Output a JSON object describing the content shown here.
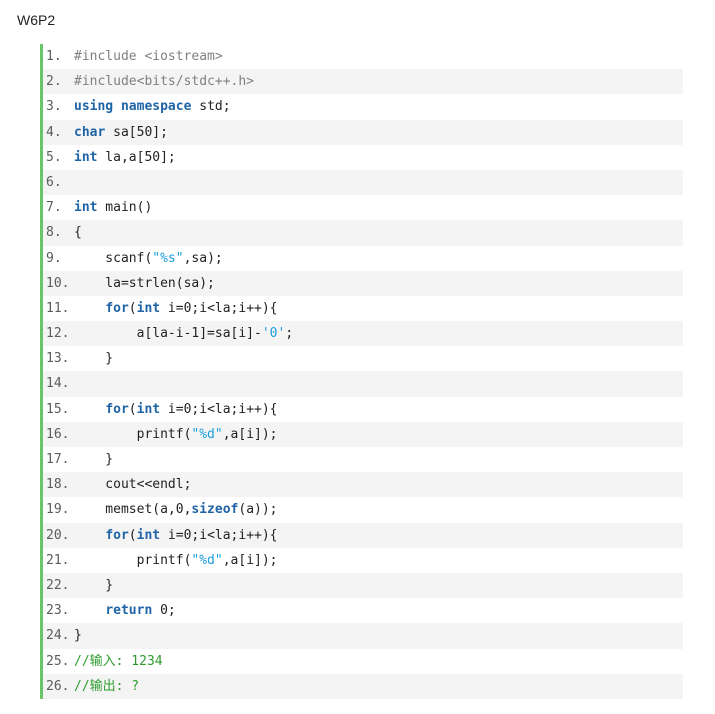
{
  "title": "W6P2",
  "lines": [
    {
      "n": "1.",
      "tokens": [
        {
          "t": "#include <iostream>",
          "c": "muted"
        }
      ]
    },
    {
      "n": "2.",
      "tokens": [
        {
          "t": "#include<bits/stdc++.h>",
          "c": "muted"
        }
      ]
    },
    {
      "n": "3.",
      "tokens": [
        {
          "t": "using",
          "c": "kw"
        },
        {
          "t": " ",
          "c": "plain"
        },
        {
          "t": "namespace",
          "c": "kw"
        },
        {
          "t": " std;",
          "c": "plain"
        }
      ]
    },
    {
      "n": "4.",
      "tokens": [
        {
          "t": "char",
          "c": "kw"
        },
        {
          "t": " sa[50];",
          "c": "plain"
        }
      ]
    },
    {
      "n": "5.",
      "tokens": [
        {
          "t": "int",
          "c": "kw"
        },
        {
          "t": " la,a[50];",
          "c": "plain"
        }
      ]
    },
    {
      "n": "6.",
      "tokens": []
    },
    {
      "n": "7.",
      "tokens": [
        {
          "t": "int",
          "c": "kw"
        },
        {
          "t": " main()",
          "c": "plain"
        }
      ]
    },
    {
      "n": "8.",
      "tokens": [
        {
          "t": "{",
          "c": "plain"
        }
      ]
    },
    {
      "n": "9.",
      "tokens": [
        {
          "t": "    scanf(",
          "c": "plain"
        },
        {
          "t": "\"%s\"",
          "c": "str"
        },
        {
          "t": ",sa);",
          "c": "plain"
        }
      ]
    },
    {
      "n": "10.",
      "tokens": [
        {
          "t": "    la=strlen(sa);",
          "c": "plain"
        }
      ]
    },
    {
      "n": "11.",
      "tokens": [
        {
          "t": "    ",
          "c": "plain"
        },
        {
          "t": "for",
          "c": "kw"
        },
        {
          "t": "(",
          "c": "plain"
        },
        {
          "t": "int",
          "c": "kw"
        },
        {
          "t": " i=0;i<la;i++){",
          "c": "plain"
        }
      ]
    },
    {
      "n": "12.",
      "tokens": [
        {
          "t": "        a[la-i-1]=sa[i]-",
          "c": "plain"
        },
        {
          "t": "'0'",
          "c": "str"
        },
        {
          "t": ";",
          "c": "plain"
        }
      ]
    },
    {
      "n": "13.",
      "tokens": [
        {
          "t": "    }",
          "c": "plain"
        }
      ]
    },
    {
      "n": "14.",
      "tokens": []
    },
    {
      "n": "15.",
      "tokens": [
        {
          "t": "    ",
          "c": "plain"
        },
        {
          "t": "for",
          "c": "kw"
        },
        {
          "t": "(",
          "c": "plain"
        },
        {
          "t": "int",
          "c": "kw"
        },
        {
          "t": " i=0;i<la;i++){",
          "c": "plain"
        }
      ]
    },
    {
      "n": "16.",
      "tokens": [
        {
          "t": "        printf(",
          "c": "plain"
        },
        {
          "t": "\"%d\"",
          "c": "str"
        },
        {
          "t": ",a[i]);",
          "c": "plain"
        }
      ]
    },
    {
      "n": "17.",
      "tokens": [
        {
          "t": "    }",
          "c": "plain"
        }
      ]
    },
    {
      "n": "18.",
      "tokens": [
        {
          "t": "    cout<<endl;",
          "c": "plain"
        }
      ]
    },
    {
      "n": "19.",
      "tokens": [
        {
          "t": "    memset(a,0,",
          "c": "plain"
        },
        {
          "t": "sizeof",
          "c": "kw"
        },
        {
          "t": "(a));",
          "c": "plain"
        }
      ]
    },
    {
      "n": "20.",
      "tokens": [
        {
          "t": "    ",
          "c": "plain"
        },
        {
          "t": "for",
          "c": "kw"
        },
        {
          "t": "(",
          "c": "plain"
        },
        {
          "t": "int",
          "c": "kw"
        },
        {
          "t": " i=0;i<la;i++){",
          "c": "plain"
        }
      ]
    },
    {
      "n": "21.",
      "tokens": [
        {
          "t": "        printf(",
          "c": "plain"
        },
        {
          "t": "\"%d\"",
          "c": "str"
        },
        {
          "t": ",a[i]);",
          "c": "plain"
        }
      ]
    },
    {
      "n": "22.",
      "tokens": [
        {
          "t": "    }",
          "c": "plain"
        }
      ]
    },
    {
      "n": "23.",
      "tokens": [
        {
          "t": "    ",
          "c": "plain"
        },
        {
          "t": "return",
          "c": "kw"
        },
        {
          "t": " 0;",
          "c": "plain"
        }
      ]
    },
    {
      "n": "24.",
      "tokens": [
        {
          "t": "}",
          "c": "plain"
        }
      ]
    },
    {
      "n": "25.",
      "tokens": [
        {
          "t": "//输入: 1234",
          "c": "comment"
        }
      ]
    },
    {
      "n": "26.",
      "tokens": [
        {
          "t": "//输出: ?",
          "c": "comment"
        }
      ]
    }
  ]
}
